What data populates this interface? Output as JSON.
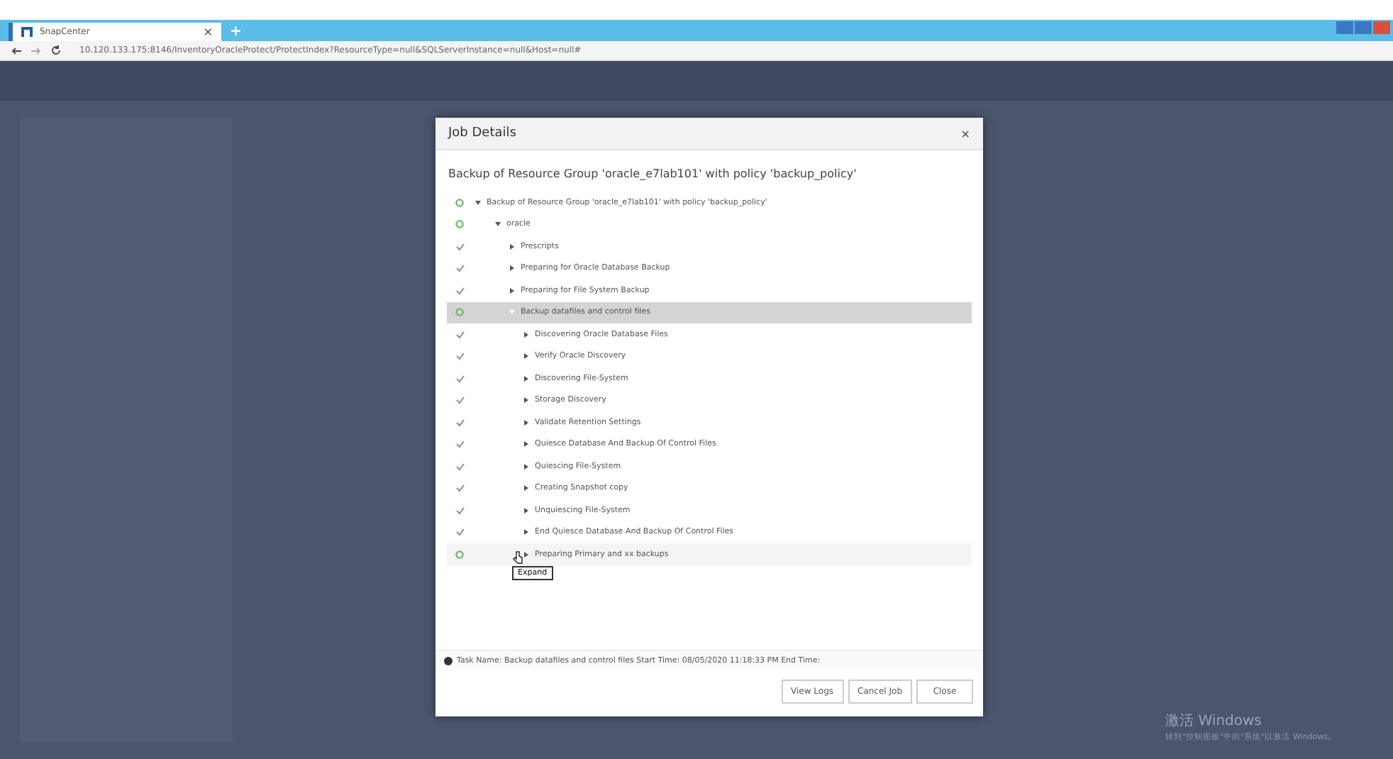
{
  "browser": {
    "tab": {
      "title": "SnapCenter",
      "close": "×"
    },
    "new_tab": "+",
    "url": "10.120.133.175:8146/InventoryOracleProtect/ProtectIndex?ResourceType=null&SQLServerInstance=null&Host=null#"
  },
  "dialog": {
    "title": "Job Details",
    "close": "×",
    "heading": "Backup of Resource Group 'oracle_e7lab101' with policy 'backup_policy'",
    "tree": [
      {
        "label": "Backup of Resource Group 'oracle_e7lab101' with policy 'backup_policy'",
        "kind": "running",
        "expanded": true,
        "selected": false,
        "children": [
          {
            "label": "oracle",
            "kind": "running",
            "expanded": true,
            "selected": false,
            "children": [
              {
                "label": "Prescripts",
                "kind": "done",
                "expanded": false,
                "selected": false
              },
              {
                "label": "Preparing for Oracle Database Backup",
                "kind": "done",
                "expanded": false,
                "selected": false
              },
              {
                "label": "Preparing for File System Backup",
                "kind": "done",
                "expanded": false,
                "selected": false
              },
              {
                "label": "Backup datafiles and control files",
                "kind": "running",
                "expanded": true,
                "selected": true,
                "children": [
                  {
                    "label": "Discovering Oracle Database Files",
                    "kind": "done",
                    "expanded": false,
                    "selected": false
                  },
                  {
                    "label": "Verify Oracle Discovery",
                    "kind": "done",
                    "expanded": false,
                    "selected": false
                  },
                  {
                    "label": "Discovering File-System",
                    "kind": "done",
                    "expanded": false,
                    "selected": false
                  },
                  {
                    "label": "Storage Discovery",
                    "kind": "done",
                    "expanded": false,
                    "selected": false
                  },
                  {
                    "label": "Validate Retention Settings",
                    "kind": "done",
                    "expanded": false,
                    "selected": false
                  },
                  {
                    "label": "Quiesce Database And Backup Of Control Files",
                    "kind": "done",
                    "expanded": false,
                    "selected": false
                  },
                  {
                    "label": "Quiescing File-System",
                    "kind": "done",
                    "expanded": false,
                    "selected": false
                  },
                  {
                    "label": "Creating Snapshot copy",
                    "kind": "done",
                    "expanded": false,
                    "selected": false
                  },
                  {
                    "label": "Unquiescing File-System",
                    "kind": "done",
                    "expanded": false,
                    "selected": false
                  },
                  {
                    "label": "End Quiesce Database And Backup Of Control Files",
                    "kind": "done",
                    "expanded": false,
                    "selected": false
                  },
                  {
                    "label": "Preparing Primary and xx backups",
                    "kind": "running",
                    "expanded": false,
                    "selected": false,
                    "hovered": true,
                    "tooltip": "Expand"
                  }
                ]
              }
            ]
          }
        ]
      }
    ],
    "info": "Task Name: Backup datafiles and control files Start Time: 08/05/2020 11:18:33 PM End Time:",
    "buttons": [
      "View Logs",
      "Cancel Job",
      "Close"
    ]
  },
  "os_notice": {
    "title": "激活 Windows",
    "text": "转到\"控制面板\"中的\"系统\"以激活 Windows。"
  }
}
